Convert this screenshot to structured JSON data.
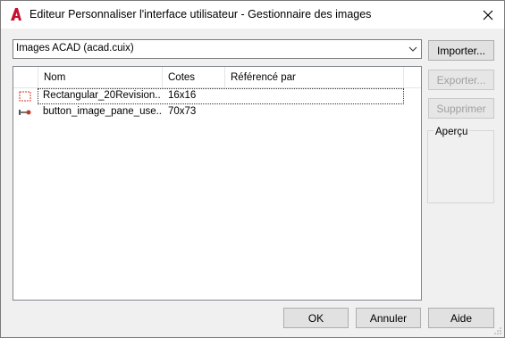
{
  "window": {
    "title": "Editeur Personnaliser l'interface utilisateur - Gestionnaire des images"
  },
  "source_combo": {
    "value": "Images ACAD (acad.cuix)"
  },
  "side_buttons": {
    "import": "Importer...",
    "export": "Exporter...",
    "delete": "Supprimer"
  },
  "listview": {
    "columns": [
      "Nom",
      "Cotes",
      "Référencé par"
    ],
    "rows": [
      {
        "name": "Rectangular_20Revision...",
        "size": "16x16",
        "ref": ""
      },
      {
        "name": "button_image_pane_use...",
        "size": "70x73",
        "ref": ""
      }
    ]
  },
  "preview": {
    "label": "Aperçu"
  },
  "footer": {
    "ok": "OK",
    "cancel": "Annuler",
    "help": "Aide"
  },
  "colors": {
    "autocad_red": "#c8102e",
    "disabled_text": "#a0a0a0"
  },
  "icons": {
    "app": "autocad-logo-icon",
    "close": "close-icon",
    "dropdown": "chevron-down-icon"
  }
}
